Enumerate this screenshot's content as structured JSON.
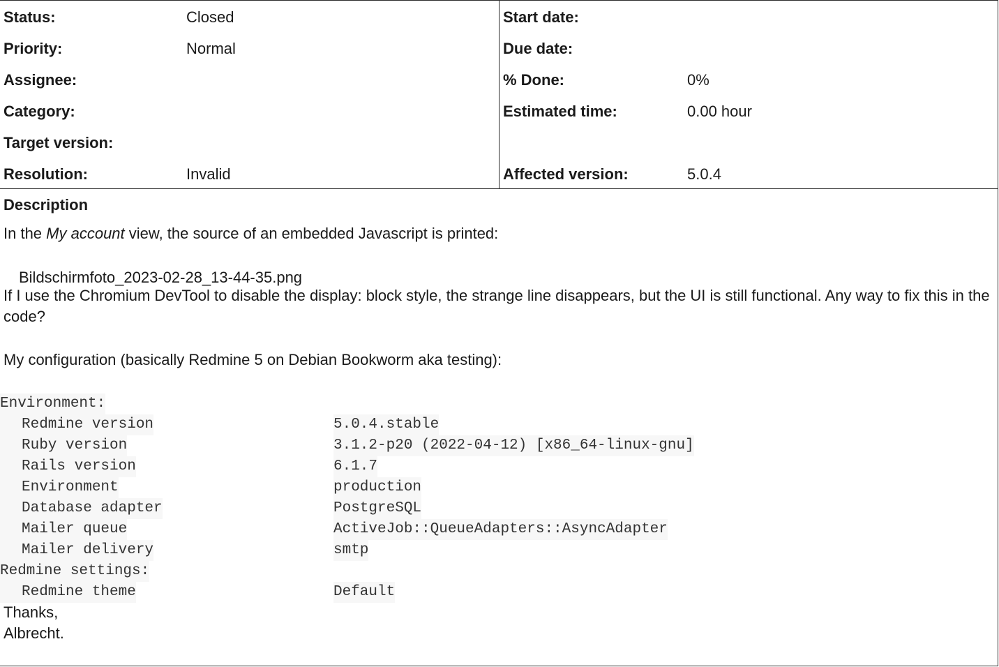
{
  "attributes": {
    "left": [
      {
        "label": "Status:",
        "value": "Closed"
      },
      {
        "label": "Priority:",
        "value": "Normal"
      },
      {
        "label": "Assignee:",
        "value": ""
      },
      {
        "label": "Category:",
        "value": ""
      },
      {
        "label": "Target version:",
        "value": ""
      },
      {
        "label": "Resolution:",
        "value": "Invalid"
      }
    ],
    "right": [
      {
        "label": "Start date:",
        "value": ""
      },
      {
        "label": "Due date:",
        "value": ""
      },
      {
        "label": "% Done:",
        "value": "0%"
      },
      {
        "label": "Estimated time:",
        "value": "0.00 hour"
      },
      {
        "label": "",
        "value": ""
      },
      {
        "label": "Affected version:",
        "value": "5.0.4"
      }
    ]
  },
  "description": {
    "title": "Description",
    "intro_before": "In the ",
    "intro_em": "My account",
    "intro_after": " view, the source of an embedded Javascript is printed:",
    "attachment": "Bildschirmfoto_2023-02-28_13-44-35.png",
    "paragraph": "If I use the Chromium DevTool to disable the display: block style, the strange line disappears, but the UI is still functional.  Any way to fix this in the code?",
    "config_intro": "My configuration (basically Redmine 5 on Debian Bookworm aka testing):",
    "environment_header": "Environment:",
    "environment": [
      {
        "key": "Redmine version",
        "value": "5.0.4.stable"
      },
      {
        "key": "Ruby version",
        "value": "3.1.2-p20 (2022-04-12) [x86_64-linux-gnu]"
      },
      {
        "key": "Rails version",
        "value": "6.1.7"
      },
      {
        "key": "Environment",
        "value": "production"
      },
      {
        "key": "Database adapter",
        "value": "PostgreSQL"
      },
      {
        "key": "Mailer queue",
        "value": "ActiveJob::QueueAdapters::AsyncAdapter"
      },
      {
        "key": "Mailer delivery",
        "value": "smtp"
      }
    ],
    "settings_header": "Redmine settings:",
    "settings": [
      {
        "key": "Redmine theme",
        "value": "Default"
      }
    ],
    "thanks": "Thanks,",
    "signature": "Albrecht."
  }
}
